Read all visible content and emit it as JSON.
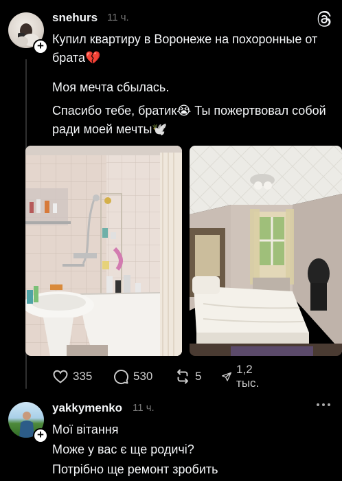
{
  "post": {
    "username": "snehurs",
    "time": "11 ч.",
    "paragraphs": [
      "Купил квартиру в Воронеже на похоронные от брата💔",
      "Моя мечта сбылась.",
      "Спасибо тебе, братик😭 Ты пожертвовал собой ради моей мечты🕊️"
    ],
    "stats": {
      "likes": "335",
      "comments": "530",
      "reposts": "5",
      "shares": "1,2 тыс."
    }
  },
  "reply": {
    "username": "yakkymenko",
    "time": "11 ч.",
    "lines": [
      "Мої вітання",
      "Може у вас є ще родичі?",
      "Потрібно ще ремонт зробить"
    ]
  },
  "icons": {
    "logo": "threads-logo-icon",
    "more": "more-icon",
    "like": "heart-icon",
    "comment": "comment-icon",
    "repost": "repost-icon",
    "share": "share-icon"
  },
  "colors": {
    "background": "#000000",
    "text": "#f3f5f7",
    "muted": "#777777"
  }
}
